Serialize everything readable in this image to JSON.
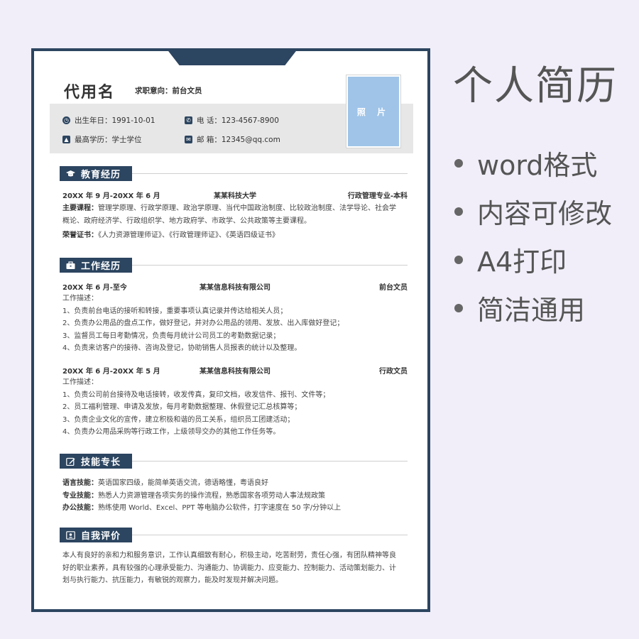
{
  "resume": {
    "name": "代用名",
    "intent": "求职意向：前台文员",
    "photo_label": "照 片",
    "info": {
      "birth": "出生年日：1991-10-01",
      "phone": "电  话：123-4567-8900",
      "degree": "最高学历：学士学位",
      "email": "邮  箱：12345@qq.com"
    },
    "education": {
      "title": "教育经历",
      "period": "20XX 年 9 月-20XX 年 6 月",
      "school": "某某科技大学",
      "major": "行政管理专业-本科",
      "courses_label": "主要课程：",
      "courses_line1": "管理学原理、行政学原理、政治学原理、当代中国政治制度、比较政治制度、法学导论、社会学",
      "courses_line2": "概论、政府经济学、行政组织学、地方政府学、市政学、公共政策等主要课程。",
      "honors_label": "荣誉证书：",
      "honors": "《人力资源管理师证》、《行政管理师证》、《英语四级证书》"
    },
    "work": {
      "title": "工作经历",
      "jobs": [
        {
          "period": "20XX 年 6 月-至今",
          "company": "某某信息科技有限公司",
          "role": "前台文员",
          "desc_label": "工作描述：",
          "lines": [
            "1、负责前台电话的接听和转接，重要事项认真记录并传达给相关人员；",
            "2、负责办公用品的盘点工作，做好登记，并对办公用品的领用、发放、出入库做好登记；",
            "3、监督员工每日考勤情况，负责每月统计公司员工的考勤数据记录；",
            "4、负责来访客户的接待、咨询及登记，协助销售人员报表的统计以及整理。"
          ]
        },
        {
          "period": "20XX 年 6 月-20XX 年 5 月",
          "company": "某某信息科技有限公司",
          "role": "行政文员",
          "desc_label": "工作描述：",
          "lines": [
            "1、负责公司前台接待及电话接转，收发传真，复印文档，收发信件、报刊、文件等；",
            "2、员工福利管理、申请及发放，每月考勤数据整理、休假登记汇总核算等；",
            "3、负责企业文化的宣传，建立积极和谐的员工关系，组织员工团建活动；",
            "4、负责办公用品采购等行政工作，上级领导交办的其他工作任务等。"
          ]
        }
      ]
    },
    "skills": {
      "title": "技能专长",
      "items": [
        {
          "label": "语言技能：",
          "text": "英语国家四级，能简单英语交流，德语略懂，粤语良好"
        },
        {
          "label": "专业技能：",
          "text": "熟悉人力资源管理各项实务的操作流程，熟悉国家各项劳动人事法规政策"
        },
        {
          "label": "办公技能：",
          "text": "熟练使用 World、Excel、PPT 等电脑办公软件，打字速度在 50 字/分钟以上"
        }
      ]
    },
    "self_eval": {
      "title": "自我评价",
      "lines": [
        "本人有良好的亲和力和服务意识，工作认真细致有耐心，积极主动，吃苦耐劳，责任心强，有团队精神等良",
        "好的职业素养，具有较强的心理承受能力、沟通能力、协调能力、应变能力、控制能力、活动策划能力、计",
        "划与执行能力、抗压能力，有敏锐的观察力，能及时发现并解决问题。"
      ]
    }
  },
  "side": {
    "title": "个人简历",
    "bullets": [
      "word格式",
      "内容可修改",
      "A4打印",
      "简洁通用"
    ]
  },
  "colors": {
    "accent": "#2c4560",
    "photo": "#9fc4e8",
    "band": "#e7e7e7",
    "background": "#f1eef9"
  }
}
